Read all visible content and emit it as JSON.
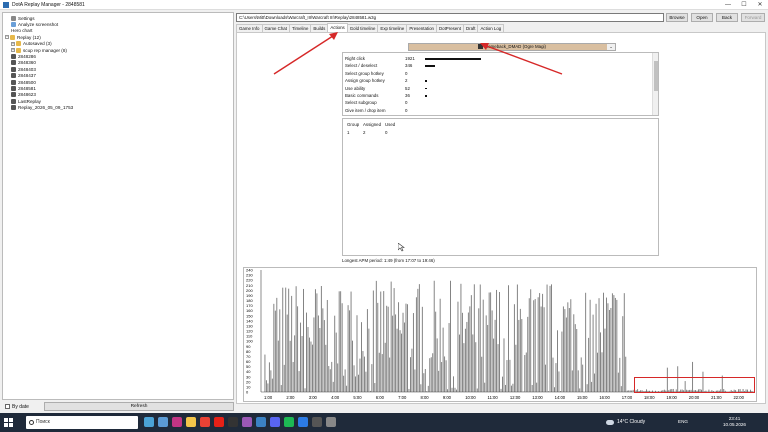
{
  "window": {
    "title": "DotA Replay Manager - 2848581"
  },
  "tree": [
    {
      "label": "Settings",
      "icon": "gear-icon",
      "indent": 1
    },
    {
      "label": "Analyze screenshot",
      "icon": "image-icon",
      "indent": 1
    },
    {
      "label": "Hero chart",
      "icon": "chart-icon",
      "indent": 1
    },
    {
      "label": "Replay (12)",
      "icon": "folder-icon",
      "indent": 0,
      "expand": "−"
    },
    {
      "label": "Autosaved (3)",
      "icon": "folder-icon",
      "indent": 1,
      "expand": "+"
    },
    {
      "label": "scup rep manager (8)",
      "icon": "folder-icon",
      "indent": 1,
      "expand": "+"
    },
    {
      "label": "2848286",
      "icon": "replay-icon",
      "indent": 1
    },
    {
      "label": "2848360",
      "icon": "replay-icon",
      "indent": 1
    },
    {
      "label": "2848403",
      "icon": "replay-icon",
      "indent": 1
    },
    {
      "label": "2848437",
      "icon": "replay-icon",
      "indent": 1
    },
    {
      "label": "2848500",
      "icon": "replay-icon",
      "indent": 1
    },
    {
      "label": "2848581",
      "icon": "replay-icon",
      "indent": 1
    },
    {
      "label": "2848623",
      "icon": "replay-icon",
      "indent": 1
    },
    {
      "label": "LastReplay",
      "icon": "replay-icon",
      "indent": 1
    },
    {
      "label": "Replay_2026_05_09_1753",
      "icon": "replay-icon",
      "indent": 1
    }
  ],
  "bottom": {
    "by_date_label": "By date",
    "refresh_label": "Refresh"
  },
  "path": {
    "value": "C:\\Users\\Mitt\\Downloads\\Warcraft_III\\Warcraft III\\Replay\\2848581.w3g"
  },
  "buttons": {
    "browse": "Browse",
    "open": "Open",
    "back": "Back",
    "forward": "Forward"
  },
  "tabs": [
    "Game Info",
    "Game Chat",
    "Timeline",
    "Builds",
    "Actions",
    "Gold timeline",
    "Exp timeline",
    "Presentation",
    "DotPresent",
    "Draft",
    "Action Log"
  ],
  "active_tab": "Actions",
  "player": {
    "name": "Comeback_DMAD (Ogre Magi)"
  },
  "actions": [
    {
      "name": "Right click",
      "value": "1921",
      "fill": 1.0
    },
    {
      "name": "Select / deselect",
      "value": "346",
      "fill": 0.18
    },
    {
      "name": "Select group hotkey",
      "value": "0",
      "fill": 0
    },
    {
      "name": "Assign group hotkey",
      "value": "2",
      "fill": 0
    },
    {
      "name": "Use ability",
      "value": "52",
      "fill": 0.03
    },
    {
      "name": "Basic commands",
      "value": "36",
      "fill": 0.02
    },
    {
      "name": "Select subgroup",
      "value": "0",
      "fill": 0
    },
    {
      "name": "Give item / drop item",
      "value": "0",
      "fill": 0
    }
  ],
  "groups": {
    "headers": [
      "Group",
      "Assigned",
      "Used"
    ],
    "rows": [
      [
        "1",
        "2",
        "0"
      ]
    ]
  },
  "apm_period_text": "Longest APM period: 1:49 (from 17:07 to 19:46)",
  "chart_data": {
    "type": "bar",
    "y_ticks": [
      "240",
      "230",
      "220",
      "210",
      "200",
      "190",
      "180",
      "170",
      "160",
      "150",
      "140",
      "130",
      "120",
      "110",
      "100",
      "90",
      "80",
      "70",
      "60",
      "50",
      "40",
      "30",
      "20",
      "10",
      "0"
    ],
    "x_ticks": [
      "1:00",
      "2:00",
      "3:00",
      "4:00",
      "5:00",
      "6:00",
      "7:00",
      "8:00",
      "9:00",
      "10:00",
      "11:00",
      "12:00",
      "13:00",
      "14:00",
      "15:00",
      "16:00",
      "17:00",
      "18:00",
      "19:00",
      "20:00",
      "21:00",
      "22:00"
    ],
    "ylim": [
      0,
      240
    ]
  },
  "taskbar": {
    "search_placeholder": "Поиск",
    "weather": "14°C Cloudy",
    "lang": "ENG",
    "time": "23:41",
    "date": "10.05.2026"
  }
}
